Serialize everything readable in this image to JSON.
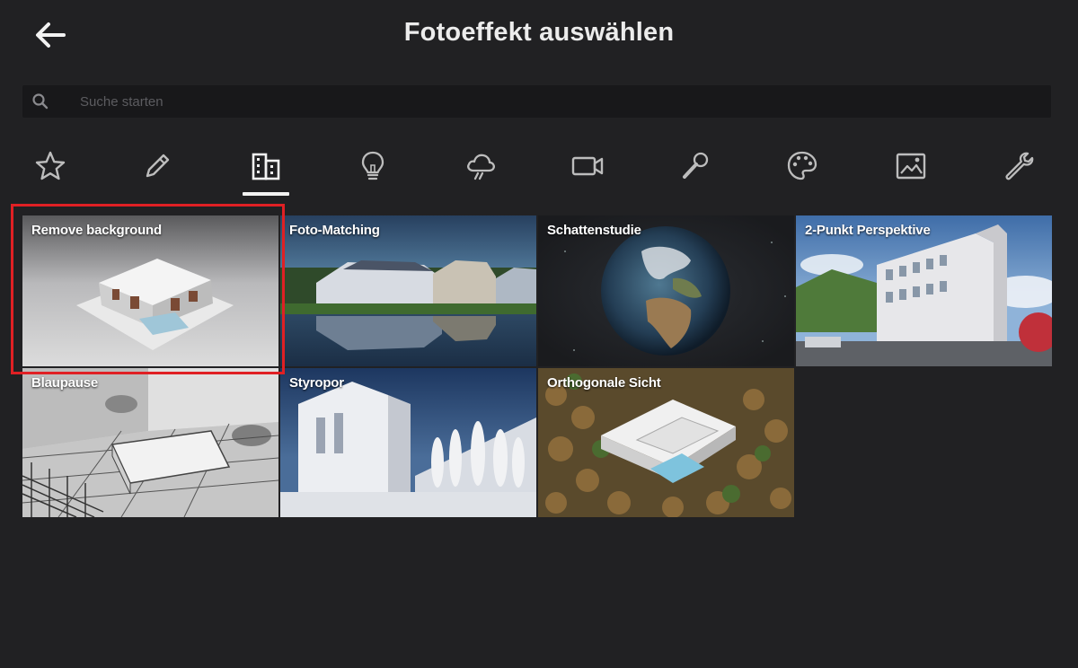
{
  "header": {
    "back_icon": "arrow-left-icon",
    "title": "Fotoeffekt auswählen"
  },
  "search": {
    "icon": "search-icon",
    "placeholder": "Suche starten",
    "value": ""
  },
  "categories": [
    {
      "icon": "star-icon",
      "selected": false
    },
    {
      "icon": "pencil-icon",
      "selected": false
    },
    {
      "icon": "buildings-icon",
      "selected": true
    },
    {
      "icon": "lightbulb-icon",
      "selected": false
    },
    {
      "icon": "weather-cloud-icon",
      "selected": false
    },
    {
      "icon": "video-camera-icon",
      "selected": false
    },
    {
      "icon": "magic-wand-icon",
      "selected": false
    },
    {
      "icon": "palette-icon",
      "selected": false
    },
    {
      "icon": "image-icon",
      "selected": false
    },
    {
      "icon": "wrench-icon",
      "selected": false
    }
  ],
  "effects": [
    {
      "label": "Remove background",
      "selected": true
    },
    {
      "label": "Foto-Matching",
      "selected": false
    },
    {
      "label": "Schattenstudie",
      "selected": false
    },
    {
      "label": "2-Punkt Perspektive",
      "selected": false
    },
    {
      "label": "Blaupause",
      "selected": false
    },
    {
      "label": "Styropor",
      "selected": false
    },
    {
      "label": "Orthogonale Sicht",
      "selected": false
    }
  ],
  "colors": {
    "background": "#212123",
    "search_bg": "#18181a",
    "icon": "#bdbdbd",
    "selection_border": "#e02024"
  }
}
